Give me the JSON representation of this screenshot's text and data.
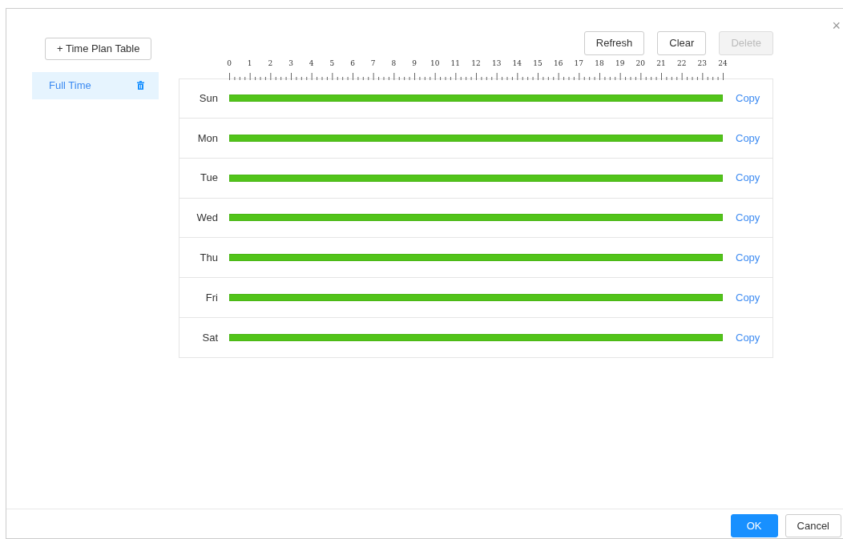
{
  "sidebar": {
    "add_button": "+ Time Plan Table",
    "items": [
      {
        "label": "Full Time",
        "selected": true
      }
    ]
  },
  "toolbar": [
    {
      "label": "Refresh",
      "disabled": false
    },
    {
      "label": "Clear",
      "disabled": false
    },
    {
      "label": "Delete",
      "disabled": true
    }
  ],
  "ruler": {
    "labels": [
      "0",
      "1",
      "2",
      "3",
      "4",
      "5",
      "6",
      "7",
      "8",
      "9",
      "10",
      "11",
      "12",
      "13",
      "14",
      "15",
      "16",
      "17",
      "18",
      "19",
      "20",
      "21",
      "22",
      "23",
      "24"
    ]
  },
  "days": [
    {
      "name": "Sun",
      "level": 1,
      "action": "Copy"
    },
    {
      "name": "Mon",
      "level": 1,
      "action": "Copy"
    },
    {
      "name": "Tue",
      "level": 1,
      "action": "Copy"
    },
    {
      "name": "Wed",
      "level": 1,
      "action": "Copy"
    },
    {
      "name": "Thu",
      "level": 1,
      "action": "Copy"
    },
    {
      "name": "Fri",
      "level": 1,
      "action": "Copy"
    },
    {
      "name": "Sat",
      "level": 1,
      "action": "Copy"
    }
  ],
  "close": "×",
  "footer": [
    {
      "label": "OK",
      "kind": "primary"
    },
    {
      "label": "Cancel",
      "kind": "secondary"
    }
  ]
}
